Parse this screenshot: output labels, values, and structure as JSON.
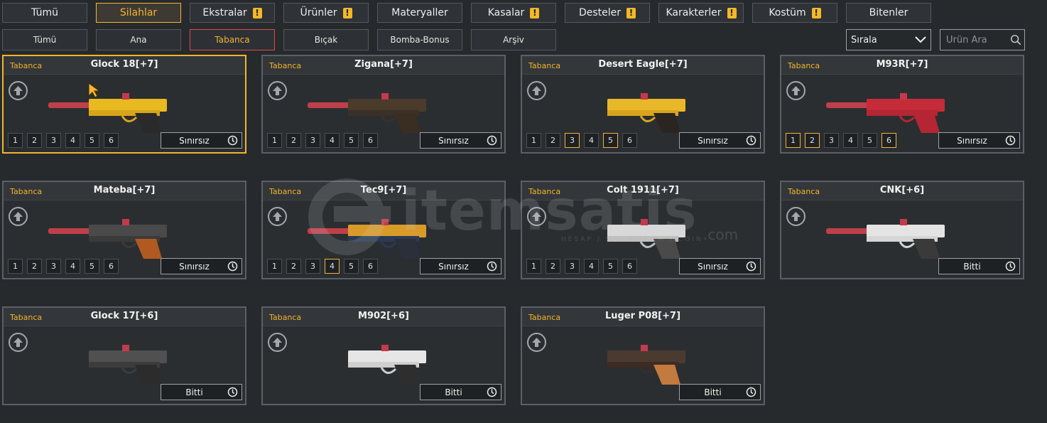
{
  "main_tabs": [
    {
      "label": "Tümü",
      "warn": false,
      "active": false
    },
    {
      "label": "Silahlar",
      "warn": false,
      "active": true
    },
    {
      "label": "Ekstralar",
      "warn": true,
      "active": false
    },
    {
      "label": "Ürünler",
      "warn": true,
      "active": false
    },
    {
      "label": "Materyaller",
      "warn": false,
      "active": false
    },
    {
      "label": "Kasalar",
      "warn": true,
      "active": false
    },
    {
      "label": "Desteler",
      "warn": true,
      "active": false
    },
    {
      "label": "Karakterler",
      "warn": true,
      "active": false
    },
    {
      "label": "Kostüm",
      "warn": true,
      "active": false
    },
    {
      "label": "Bitenler",
      "warn": false,
      "active": false
    }
  ],
  "warn_glyph": "!",
  "sub_tabs": [
    {
      "label": "Tümü",
      "active": false
    },
    {
      "label": "Ana",
      "active": false
    },
    {
      "label": "Tabanca",
      "active": true
    },
    {
      "label": "Bıçak",
      "active": false
    },
    {
      "label": "Bomba-Bonus",
      "active": false
    },
    {
      "label": "Arşiv",
      "active": false
    }
  ],
  "sort": {
    "label": "Sırala"
  },
  "search": {
    "placeholder": "Ürün Ara"
  },
  "watermark": {
    "text": "itemsatis",
    "dotcom": ".com",
    "sub": "HESAP / SKIN / ITEM / COIN"
  },
  "colors": {
    "accent": "#f3b42e",
    "active_subtab_border": "#d94b4b",
    "background": "#272a2d"
  },
  "cards": [
    {
      "category": "Tabanca",
      "name": "Glock 18[+7]",
      "status": "Sınırsız",
      "levels": [
        "1",
        "2",
        "3",
        "4",
        "5",
        "6"
      ],
      "active_levels": [],
      "selected": true,
      "gun": "pistol-gold"
    },
    {
      "category": "Tabanca",
      "name": "Zigana[+7]",
      "status": "Sınırsız",
      "levels": [
        "1",
        "2",
        "3",
        "4",
        "5",
        "6"
      ],
      "active_levels": [],
      "selected": false,
      "gun": "pistol-dark"
    },
    {
      "category": "Tabanca",
      "name": "Desert Eagle[+7]",
      "status": "Sınırsız",
      "levels": [
        "1",
        "2",
        "3",
        "4",
        "5",
        "6"
      ],
      "active_levels": [
        "3",
        "5"
      ],
      "selected": false,
      "gun": "deagle-gold"
    },
    {
      "category": "Tabanca",
      "name": "M93R[+7]",
      "status": "Sınırsız",
      "levels": [
        "1",
        "2",
        "3",
        "4",
        "5",
        "6"
      ],
      "active_levels": [
        "1",
        "2",
        "6"
      ],
      "selected": false,
      "gun": "pistol-red"
    },
    {
      "category": "Tabanca",
      "name": "Mateba[+7]",
      "status": "Sınırsız",
      "levels": [
        "1",
        "2",
        "3",
        "4",
        "5",
        "6"
      ],
      "active_levels": [],
      "selected": false,
      "gun": "revolver"
    },
    {
      "category": "Tabanca",
      "name": "Tec9[+7]",
      "status": "Sınırsız",
      "levels": [
        "1",
        "2",
        "3",
        "4",
        "5",
        "6"
      ],
      "active_levels": [
        "4"
      ],
      "selected": false,
      "gun": "smg"
    },
    {
      "category": "Tabanca",
      "name": "Colt 1911[+7]",
      "status": "Sınırsız",
      "levels": [
        "1",
        "2",
        "3",
        "4",
        "5",
        "6"
      ],
      "active_levels": [],
      "selected": false,
      "gun": "pistol-silver"
    },
    {
      "category": "Tabanca",
      "name": "CNK[+6]",
      "status": "Bitti",
      "levels": [],
      "active_levels": [],
      "selected": false,
      "gun": "pistol-white"
    },
    {
      "category": "Tabanca",
      "name": "Glock 17[+6]",
      "status": "Bitti",
      "levels": [],
      "active_levels": [],
      "selected": false,
      "gun": "pistol-black"
    },
    {
      "category": "Tabanca",
      "name": "M902[+6]",
      "status": "Bitti",
      "levels": [],
      "active_levels": [],
      "selected": false,
      "gun": "pistol-chrome"
    },
    {
      "category": "Tabanca",
      "name": "Luger P08[+7]",
      "status": "Bitti",
      "levels": [],
      "active_levels": [],
      "selected": false,
      "gun": "luger"
    }
  ]
}
